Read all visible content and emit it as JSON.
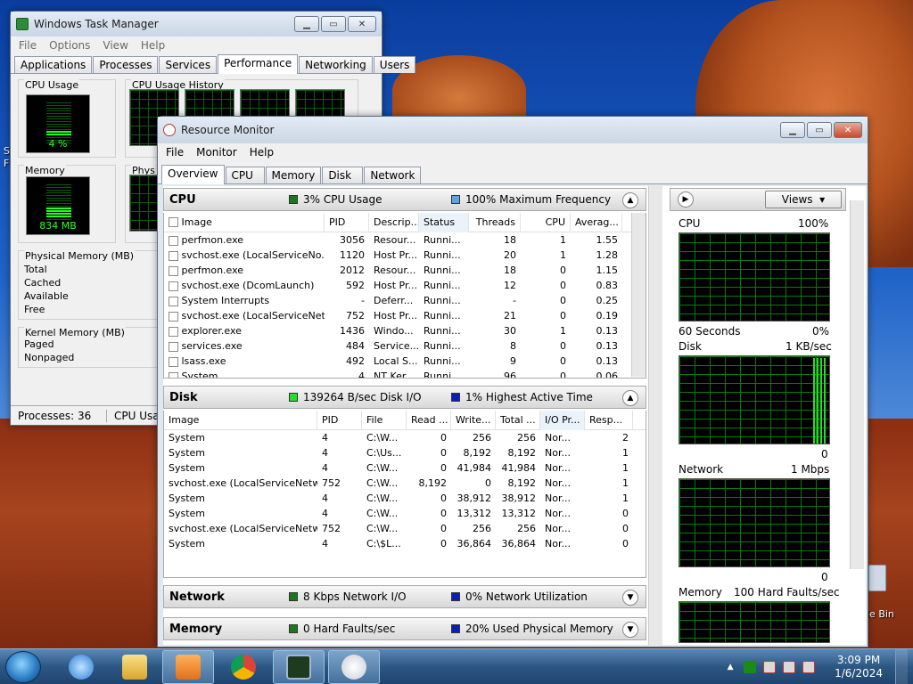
{
  "desktop": {
    "recycle_label": "le Bin",
    "edge_text_1": "S",
    "edge_text_2": "F"
  },
  "task_manager": {
    "title": "Windows Task Manager",
    "menu": [
      "File",
      "Options",
      "View",
      "Help"
    ],
    "tabs": [
      "Applications",
      "Processes",
      "Services",
      "Performance",
      "Networking",
      "Users"
    ],
    "active_tab": "Performance",
    "cpu_usage_title": "CPU Usage",
    "cpu_usage_value": "4 %",
    "cpu_history_title": "CPU Usage History",
    "memory_title": "Memory",
    "memory_value": "834 MB",
    "phys_history_title": "Phys",
    "physical_memory_title": "Physical Memory (MB)",
    "physical_memory_rows": [
      "Total",
      "Cached",
      "Available",
      "Free"
    ],
    "kernel_memory_title": "Kernel Memory (MB)",
    "kernel_memory_rows": [
      "Paged",
      "Nonpaged"
    ],
    "status_processes": "Processes: 36",
    "status_cpu": "CPU Usag"
  },
  "resource_monitor": {
    "title": "Resource Monitor",
    "menu": [
      "File",
      "Monitor",
      "Help"
    ],
    "tabs": [
      "Overview",
      "CPU",
      "Memory",
      "Disk",
      "Network"
    ],
    "active_tab": "Overview",
    "cpu": {
      "title": "CPU",
      "stat1": "3% CPU Usage",
      "stat2": "100% Maximum Frequency",
      "columns": [
        "Image",
        "PID",
        "Descrip...",
        "Status",
        "Threads",
        "CPU",
        "Averag..."
      ],
      "rows": [
        [
          "perfmon.exe",
          "3056",
          "Resour...",
          "Runni...",
          "18",
          "1",
          "1.55"
        ],
        [
          "svchost.exe (LocalServiceNo...",
          "1120",
          "Host Pr...",
          "Runni...",
          "20",
          "1",
          "1.28"
        ],
        [
          "perfmon.exe",
          "2012",
          "Resour...",
          "Runni...",
          "18",
          "0",
          "1.15"
        ],
        [
          "svchost.exe (DcomLaunch)",
          "592",
          "Host Pr...",
          "Runni...",
          "12",
          "0",
          "0.83"
        ],
        [
          "System Interrupts",
          "-",
          "Deferr...",
          "Runni...",
          "-",
          "0",
          "0.25"
        ],
        [
          "svchost.exe (LocalServiceNet...",
          "752",
          "Host Pr...",
          "Runni...",
          "21",
          "0",
          "0.19"
        ],
        [
          "explorer.exe",
          "1436",
          "Windo...",
          "Runni...",
          "30",
          "1",
          "0.13"
        ],
        [
          "services.exe",
          "484",
          "Service...",
          "Runni...",
          "8",
          "0",
          "0.13"
        ],
        [
          "lsass.exe",
          "492",
          "Local S...",
          "Runni...",
          "9",
          "0",
          "0.13"
        ],
        [
          "System",
          "4",
          "NT Ker...",
          "Runni...",
          "96",
          "0",
          "0.06"
        ]
      ]
    },
    "disk": {
      "title": "Disk",
      "stat1": "139264 B/sec Disk I/O",
      "stat2": "1% Highest Active Time",
      "columns": [
        "Image",
        "PID",
        "File",
        "Read ...",
        "Write...",
        "Total ...",
        "I/O Pr...",
        "Resp..."
      ],
      "rows": [
        [
          "System",
          "4",
          "C:\\W...",
          "0",
          "256",
          "256",
          "Nor...",
          "2"
        ],
        [
          "System",
          "4",
          "C:\\Us...",
          "0",
          "8,192",
          "8,192",
          "Nor...",
          "1"
        ],
        [
          "System",
          "4",
          "C:\\W...",
          "0",
          "41,984",
          "41,984",
          "Nor...",
          "1"
        ],
        [
          "svchost.exe (LocalServiceNetw...",
          "752",
          "C:\\W...",
          "8,192",
          "0",
          "8,192",
          "Nor...",
          "1"
        ],
        [
          "System",
          "4",
          "C:\\W...",
          "0",
          "38,912",
          "38,912",
          "Nor...",
          "1"
        ],
        [
          "System",
          "4",
          "C:\\W...",
          "0",
          "13,312",
          "13,312",
          "Nor...",
          "0"
        ],
        [
          "svchost.exe (LocalServiceNetw...",
          "752",
          "C:\\W...",
          "0",
          "256",
          "256",
          "Nor...",
          "0"
        ],
        [
          "System",
          "4",
          "C:\\$L...",
          "0",
          "36,864",
          "36,864",
          "Nor...",
          "0"
        ]
      ]
    },
    "network": {
      "title": "Network",
      "stat1": "8 Kbps Network I/O",
      "stat2": "0% Network Utilization"
    },
    "memory": {
      "title": "Memory",
      "stat1": "0 Hard Faults/sec",
      "stat2": "20% Used Physical Memory"
    },
    "colors": {
      "green": "#22cc22",
      "blue": "#0a1fb8",
      "light_blue": "#5ba3e6"
    },
    "right_pane": {
      "views_label": "Views",
      "cpu_label": "CPU",
      "cpu_value": "100%",
      "cpu_footer_left": "60 Seconds",
      "cpu_footer_right": "0%",
      "disk_label": "Disk",
      "disk_value": "1 KB/sec",
      "disk_footer_right": "0",
      "network_label": "Network",
      "network_value": "1 Mbps",
      "network_footer_right": "0",
      "memory_label": "Memory",
      "memory_value": "100 Hard Faults/sec"
    }
  },
  "taskbar": {
    "time": "3:09 PM",
    "date": "1/6/2024"
  }
}
